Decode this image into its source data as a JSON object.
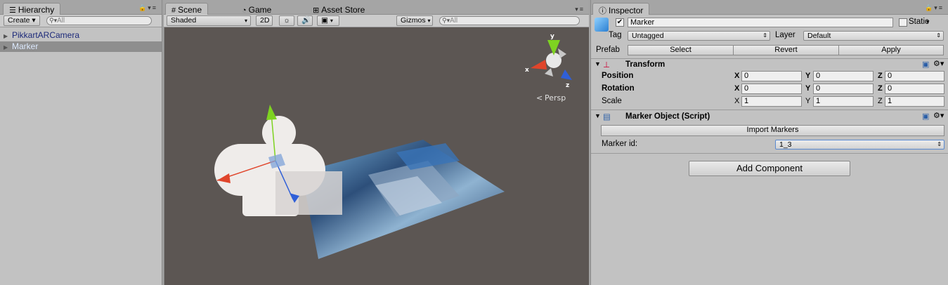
{
  "hierarchy": {
    "tab": "Hierarchy",
    "create_label": "Create",
    "search_placeholder": "All",
    "items": [
      {
        "label": "PikkartARCamera",
        "selected": false
      },
      {
        "label": "Marker",
        "selected": true
      }
    ]
  },
  "scene": {
    "tabs": [
      {
        "label": "Scene",
        "icon": "grid-icon"
      },
      {
        "label": "Game",
        "icon": "pacman-icon"
      },
      {
        "label": "Asset Store",
        "icon": "store-icon"
      }
    ],
    "shading_mode": "Shaded",
    "mode_2d": "2D",
    "gizmos_label": "Gizmos",
    "search_placeholder": "All",
    "persp_label": "Persp",
    "axis_labels": {
      "x": "x",
      "y": "y",
      "z": "z"
    },
    "colors": {
      "x_axis": "#e0452b",
      "y_axis": "#7ed321",
      "z_axis": "#2f5fd8",
      "viewport": "#5c5653"
    }
  },
  "inspector": {
    "tab": "Inspector",
    "object_name": "Marker",
    "static_label": "Static",
    "tag_label": "Tag",
    "tag_value": "Untagged",
    "layer_label": "Layer",
    "layer_value": "Default",
    "prefab_label": "Prefab",
    "prefab_buttons": [
      "Select",
      "Revert",
      "Apply"
    ],
    "transform": {
      "title": "Transform",
      "rows": [
        {
          "label": "Position",
          "x": "0",
          "y": "0",
          "z": "0"
        },
        {
          "label": "Rotation",
          "x": "0",
          "y": "0",
          "z": "0"
        },
        {
          "label": "Scale",
          "x": "1",
          "y": "1",
          "z": "1"
        }
      ]
    },
    "marker_script": {
      "title": "Marker Object (Script)",
      "import_button": "Import Markers",
      "marker_id_label": "Marker id:",
      "marker_id_value": "1_3"
    },
    "add_component": "Add Component",
    "axis_letters": [
      "X",
      "Y",
      "Z"
    ]
  }
}
